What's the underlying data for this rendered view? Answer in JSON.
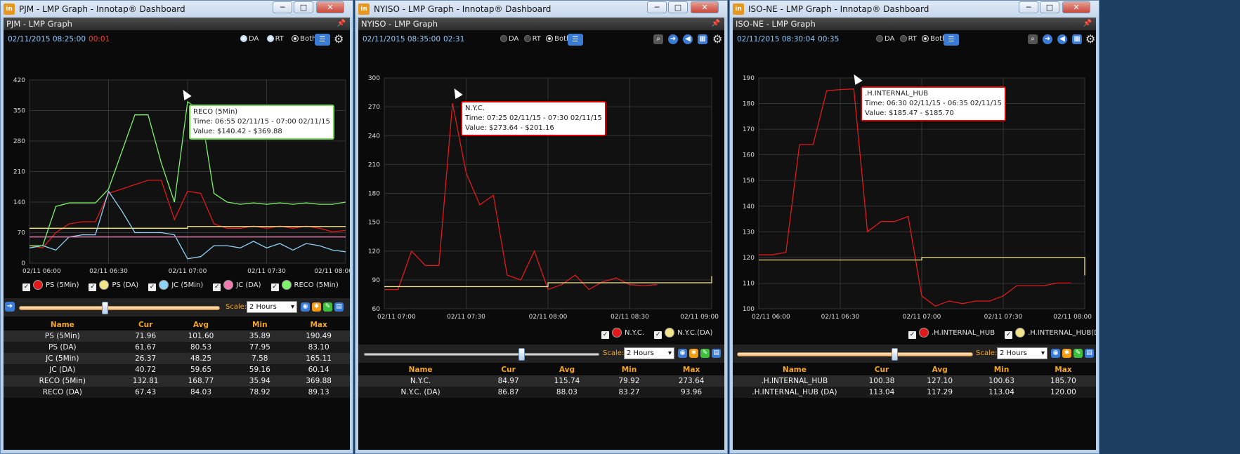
{
  "windows": [
    {
      "title": "PJM - LMP Graph - Innotap® Dashboard",
      "panel_title": "PJM - LMP Graph",
      "timestamp": "02/11/2015 08:25:00",
      "countdown": "00:01",
      "radio_options": [
        "DA",
        "RT",
        "Both"
      ],
      "selected_radio": "Both",
      "legend": [
        {
          "label": "PS (5Min)",
          "color": "#e01a1a"
        },
        {
          "label": "PS (DA)",
          "color": "#f2e48a"
        },
        {
          "label": "JC (5Min)",
          "color": "#8fd1f5"
        },
        {
          "label": "JC (DA)",
          "color": "#f07ab0"
        },
        {
          "label": "RECO (5Min)",
          "color": "#7ef06a"
        }
      ],
      "scale_label": "Scale:",
      "scale_value": "2 Hours",
      "table": {
        "headers": [
          "Name",
          "Cur",
          "Avg",
          "Min",
          "Max"
        ],
        "rows": [
          [
            "PS (5Min)",
            "71.96",
            "101.60",
            "35.89",
            "190.49"
          ],
          [
            "PS (DA)",
            "61.67",
            "80.53",
            "77.95",
            "83.10"
          ],
          [
            "JC (5Min)",
            "26.37",
            "48.25",
            "7.58",
            "165.11"
          ],
          [
            "JC (DA)",
            "40.72",
            "59.65",
            "59.16",
            "60.14"
          ],
          [
            "RECO (5Min)",
            "132.81",
            "168.77",
            "35.94",
            "369.88"
          ],
          [
            "RECO (DA)",
            "67.43",
            "84.03",
            "78.92",
            "89.13"
          ]
        ]
      },
      "tooltip": {
        "title": "RECO (5Min)",
        "time": "Time: 06:55 02/11/15 - 07:00 02/11/15",
        "value": "Value: $140.42 - $369.88"
      }
    },
    {
      "title": "NYISO - LMP Graph - Innotap® Dashboard",
      "panel_title": "NYISO - LMP Graph",
      "timestamp": "02/11/2015 08:35:00",
      "countdown": "02:31",
      "radio_options": [
        "DA",
        "RT",
        "Both"
      ],
      "selected_radio": "Both",
      "legend": [
        {
          "label": "N.Y.C.",
          "color": "#e01a1a"
        },
        {
          "label": "N.Y.C.(DA)",
          "color": "#f2e48a"
        }
      ],
      "scale_label": "Scale:",
      "scale_value": "2 Hours",
      "table": {
        "headers": [
          "Name",
          "Cur",
          "Avg",
          "Min",
          "Max"
        ],
        "rows": [
          [
            "N.Y.C.",
            "84.97",
            "115.74",
            "79.92",
            "273.64"
          ],
          [
            "N.Y.C. (DA)",
            "86.87",
            "88.03",
            "83.27",
            "93.96"
          ]
        ]
      },
      "tooltip": {
        "title": "N.Y.C.",
        "time": "Time: 07:25 02/11/15 - 07:30 02/11/15",
        "value": "Value: $273.64 - $201.16"
      }
    },
    {
      "title": "ISO-NE - LMP Graph - Innotap® Dashboard",
      "panel_title": "ISO-NE - LMP Graph",
      "timestamp": "02/11/2015 08:30:04",
      "countdown": "00:35",
      "radio_options": [
        "DA",
        "RT",
        "Both"
      ],
      "selected_radio": "Both",
      "legend": [
        {
          "label": ".H.INTERNAL_HUB",
          "color": "#e01a1a"
        },
        {
          "label": ".H.INTERNAL_HUB(DA)",
          "color": "#f2e48a"
        }
      ],
      "scale_label": "Scale:",
      "scale_value": "2 Hours",
      "table": {
        "headers": [
          "Name",
          "Cur",
          "Avg",
          "Min",
          "Max"
        ],
        "rows": [
          [
            ".H.INTERNAL_HUB",
            "100.38",
            "127.10",
            "100.63",
            "185.70"
          ],
          [
            ".H.INTERNAL_HUB (DA)",
            "113.04",
            "117.29",
            "113.04",
            "120.00"
          ]
        ]
      },
      "tooltip": {
        "title": ".H.INTERNAL_HUB",
        "time": "Time: 06:30 02/11/15 - 06:35 02/11/15",
        "value": "Value: $185.47 - $185.70"
      }
    }
  ],
  "chart_data": [
    {
      "type": "line",
      "x_ticks": [
        "02/11 06:00",
        "02/11 06:30",
        "02/11 07:00",
        "02/11 07:30",
        "02/11 08:00"
      ],
      "x_range_minutes": [
        0,
        120
      ],
      "ylim": [
        0,
        420
      ],
      "y_ticks": [
        0,
        70,
        140,
        210,
        280,
        350,
        420
      ],
      "series": [
        {
          "name": "PS (5Min)",
          "color": "#e01a1a",
          "x": [
            0,
            5,
            10,
            15,
            20,
            25,
            30,
            35,
            40,
            45,
            50,
            55,
            60,
            65,
            70,
            75,
            80,
            85,
            90,
            95,
            100,
            105,
            110,
            115,
            120
          ],
          "y": [
            40,
            35,
            70,
            90,
            95,
            95,
            160,
            170,
            180,
            190,
            190,
            100,
            165,
            160,
            90,
            80,
            80,
            85,
            80,
            85,
            80,
            85,
            80,
            72,
            75
          ]
        },
        {
          "name": "PS (DA)",
          "color": "#f2e48a",
          "x": [
            0,
            60,
            60,
            120
          ],
          "y": [
            80,
            80,
            84,
            84
          ]
        },
        {
          "name": "JC (5Min)",
          "color": "#8fd1f5",
          "x": [
            0,
            5,
            10,
            15,
            20,
            25,
            30,
            35,
            40,
            45,
            50,
            55,
            60,
            65,
            70,
            75,
            80,
            85,
            90,
            95,
            100,
            105,
            110,
            115,
            120
          ],
          "y": [
            35,
            40,
            30,
            60,
            65,
            65,
            165,
            120,
            70,
            70,
            70,
            65,
            10,
            15,
            40,
            40,
            35,
            50,
            35,
            45,
            30,
            45,
            40,
            30,
            26
          ]
        },
        {
          "name": "JC (DA)",
          "color": "#f07ab0",
          "x": [
            0,
            120
          ],
          "y": [
            60,
            60
          ]
        },
        {
          "name": "RECO (5Min)",
          "color": "#7ef06a",
          "x": [
            0,
            5,
            10,
            15,
            20,
            25,
            30,
            35,
            40,
            45,
            50,
            55,
            60,
            65,
            70,
            75,
            80,
            85,
            90,
            95,
            100,
            105,
            110,
            115,
            120
          ],
          "y": [
            40,
            40,
            130,
            138,
            138,
            138,
            170,
            255,
            340,
            340,
            230,
            140,
            369.88,
            350,
            160,
            140,
            135,
            138,
            135,
            138,
            135,
            138,
            135,
            135,
            140
          ]
        }
      ]
    },
    {
      "type": "line",
      "x_ticks": [
        "02/11 07:00",
        "02/11 07:30",
        "02/11 08:00",
        "02/11 08:30",
        "02/11 09:00"
      ],
      "x_range_minutes": [
        0,
        120
      ],
      "ylim": [
        60,
        300
      ],
      "y_ticks": [
        60,
        90,
        120,
        150,
        180,
        210,
        240,
        270,
        300
      ],
      "series": [
        {
          "name": "N.Y.C.",
          "color": "#e01a1a",
          "x": [
            0,
            5,
            10,
            15,
            20,
            25,
            30,
            35,
            40,
            45,
            50,
            55,
            60,
            65,
            70,
            75,
            80,
            85,
            90,
            95,
            100
          ],
          "y": [
            80,
            80,
            120,
            105,
            105,
            273.64,
            201.16,
            168,
            178,
            95,
            90,
            120,
            80,
            85,
            95,
            80,
            88,
            92,
            85,
            84,
            85
          ]
        },
        {
          "name": "N.Y.C.(DA)",
          "color": "#f2e48a",
          "x": [
            0,
            60,
            60,
            120,
            120
          ],
          "y": [
            83,
            83,
            87,
            87,
            94
          ]
        }
      ]
    },
    {
      "type": "line",
      "x_ticks": [
        "02/11 06:00",
        "02/11 06:30",
        "02/11 07:00",
        "02/11 07:30",
        "02/11 08:00"
      ],
      "x_range_minutes": [
        0,
        120
      ],
      "ylim": [
        100,
        190
      ],
      "y_ticks": [
        100,
        110,
        120,
        130,
        140,
        150,
        160,
        170,
        180,
        190
      ],
      "series": [
        {
          "name": ".H.INTERNAL_HUB",
          "color": "#e01a1a",
          "x": [
            0,
            5,
            10,
            15,
            20,
            25,
            30,
            35,
            40,
            45,
            50,
            55,
            60,
            65,
            70,
            75,
            80,
            85,
            90,
            95,
            100,
            105,
            110,
            115
          ],
          "y": [
            121,
            121,
            122,
            164,
            164,
            185,
            185.47,
            185.7,
            130,
            134,
            134,
            136,
            105,
            101,
            103,
            102,
            103,
            103,
            105,
            109,
            109,
            109,
            110,
            110
          ]
        },
        {
          "name": ".H.INTERNAL_HUB(DA)",
          "color": "#f2e48a",
          "x": [
            0,
            60,
            60,
            120,
            120
          ],
          "y": [
            119,
            119,
            120,
            120,
            113
          ]
        }
      ]
    }
  ]
}
